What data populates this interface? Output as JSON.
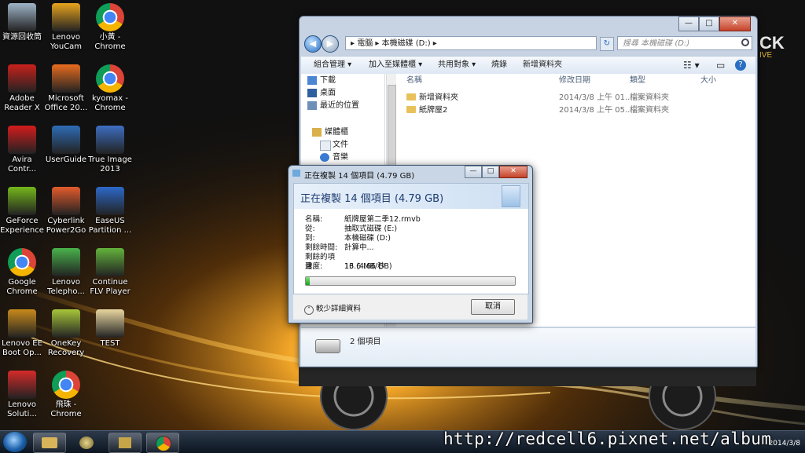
{
  "desktop": {
    "icons": [
      {
        "label": "資源回收筒",
        "icon": "recycle-bin"
      },
      {
        "label": "Lenovo YouCam",
        "icon": "webcam"
      },
      {
        "label": "小黃 - Chrome",
        "icon": "chrome"
      },
      {
        "label": "Adobe Reader X",
        "icon": "adobe-reader"
      },
      {
        "label": "Microsoft Office 20...",
        "icon": "office"
      },
      {
        "label": "kyomax - Chrome",
        "icon": "chrome"
      },
      {
        "label": "Avira Contr...",
        "icon": "avira"
      },
      {
        "label": "UserGuide",
        "icon": "lenovo-guide"
      },
      {
        "label": "True Image 2013",
        "icon": "true-image"
      },
      {
        "label": "GeForce Experience",
        "icon": "nvidia"
      },
      {
        "label": "Cyberlink Power2Go",
        "icon": "power2go"
      },
      {
        "label": "EaseUS Partition ...",
        "icon": "easeus"
      },
      {
        "label": "Google Chrome",
        "icon": "chrome"
      },
      {
        "label": "Lenovo Telepho...",
        "icon": "lenovo-phone"
      },
      {
        "label": "Continue FLV Player",
        "icon": "flv-player"
      },
      {
        "label": "Lenovo EE Boot Op...",
        "icon": "lenovo-boot"
      },
      {
        "label": "OneKey Recovery",
        "icon": "onekey"
      },
      {
        "label": "TEST",
        "icon": "folder"
      },
      {
        "label": "Lenovo Soluti...",
        "icon": "lenovo-solutions"
      },
      {
        "label": "飛珠 - Chrome",
        "icon": "chrome"
      }
    ],
    "wallpaper_text": "CK",
    "wallpaper_sub": "IVE"
  },
  "explorer": {
    "address": "▸ 電腦 ▸ 本機磁碟 (D:) ▸",
    "search_placeholder": "搜尋 本機磁碟 (D:)",
    "toolbar": [
      "組合管理 ▾",
      "加入至媒體櫃 ▾",
      "共用對象 ▾",
      "燒錄",
      "新增資料夾"
    ],
    "nav_items": [
      "下載",
      "桌面",
      "最近的位置",
      "媒體櫃",
      "文件",
      "音樂"
    ],
    "columns": [
      "名稱",
      "修改日期",
      "類型",
      "大小"
    ],
    "files": [
      {
        "name": "新增資料夾",
        "date": "2014/3/8 上午 01...",
        "type": "檔案資料夾"
      },
      {
        "name": "紙牌屋2",
        "date": "2014/3/8 上午 05...",
        "type": "檔案資料夾"
      }
    ],
    "status": "2 個項目",
    "buttons": {
      "minimize": "—",
      "maximize": "□",
      "close": "✕"
    }
  },
  "copy_dialog": {
    "title": "正在複製 14 個項目 (4.79 GB)",
    "heading": "正在複製 14 個項目 (4.79 GB)",
    "rows": [
      {
        "key": "名稱:",
        "value": "紙牌屋第二季12.rmvb"
      },
      {
        "key": "從:",
        "value": "抽取式磁碟 (E:)"
      },
      {
        "key": "到:",
        "value": "本機磁碟 (D:)"
      },
      {
        "key": "剩餘時間:",
        "value": "計算中..."
      },
      {
        "key": "剩餘的項目:",
        "value": "13 (4.66 GB)"
      },
      {
        "key": "速度:",
        "value": "16.6 MB/秒"
      }
    ],
    "progress": 0.02,
    "less_details": "較少詳細資料",
    "cancel": "取消"
  },
  "taskbar": {
    "clock_time": "",
    "clock_date": "2014/3/8"
  },
  "watermark": "http://redcell6.pixnet.net/album"
}
